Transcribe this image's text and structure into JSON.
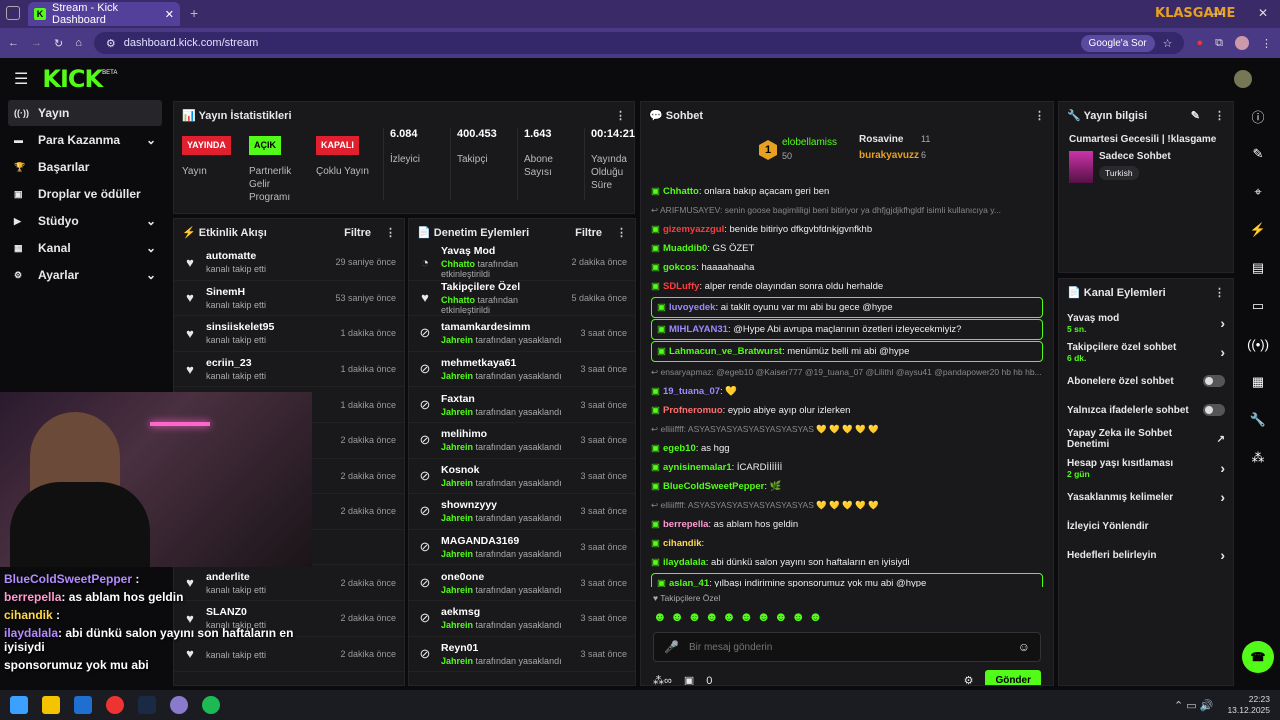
{
  "browser": {
    "tab_title": "Stream - Kick Dashboard",
    "url": "dashboard.kick.com/stream",
    "google_btn": "Google'a Sor",
    "overlay_logo": "KLASGAME"
  },
  "header": {
    "logo": "KICK",
    "beta": "BETA"
  },
  "sidebar": {
    "items": [
      {
        "label": "Yayın",
        "icon": "stream-icon",
        "expand": false
      },
      {
        "label": "Para Kazanma",
        "icon": "money-icon",
        "expand": true
      },
      {
        "label": "Başarılar",
        "icon": "trophy-icon",
        "expand": false
      },
      {
        "label": "Droplar ve ödüller",
        "icon": "gift-icon",
        "expand": false
      },
      {
        "label": "Stüdyo",
        "icon": "video-icon",
        "expand": true
      },
      {
        "label": "Kanal",
        "icon": "channel-icon",
        "expand": true
      },
      {
        "label": "Ayarlar",
        "icon": "gear-icon",
        "expand": true
      }
    ]
  },
  "stats": {
    "title": "Yayın İstatistikleri",
    "items": [
      {
        "badge": "YAYINDA",
        "label": "Yayın"
      },
      {
        "badge": "AÇIK",
        "label": "Partnerlik Gelir Programı"
      },
      {
        "badge": "KAPALI",
        "label": "Çoklu Yayın"
      },
      {
        "value": "6.084",
        "label": "İzleyici"
      },
      {
        "value": "400.453",
        "label": "Takipçi"
      },
      {
        "value": "1.643",
        "label": "Abone Sayısı"
      },
      {
        "value": "00:14:21",
        "label": "Yayında Olduğu Süre"
      }
    ]
  },
  "activity": {
    "title": "Etkinlik Akışı",
    "filter": "Filtre",
    "rows": [
      {
        "name": "automatte",
        "sub": "kanalı takip etti",
        "time": "29 saniye önce"
      },
      {
        "name": "SinemH",
        "sub": "kanalı takip etti",
        "time": "53 saniye önce"
      },
      {
        "name": "sinsiiskelet95",
        "sub": "kanalı takip etti",
        "time": "1 dakika önce"
      },
      {
        "name": "ecriin_23",
        "sub": "kanalı takip etti",
        "time": "1 dakika önce"
      },
      {
        "name": "",
        "sub": "",
        "time": "1 dakika önce"
      },
      {
        "name": "",
        "sub": "",
        "time": "2 dakika önce"
      },
      {
        "name": "",
        "sub": "",
        "time": "2 dakika önce"
      },
      {
        "name": "",
        "sub": "r! Toplam abonelik",
        "time": "2 dakika önce"
      },
      {
        "name": "",
        "sub": "",
        "time": ""
      },
      {
        "name": "anderlite",
        "sub": "kanalı takip etti",
        "time": "2 dakika önce"
      },
      {
        "name": "SLANZ0",
        "sub": "kanalı takip etti",
        "time": "2 dakika önce"
      },
      {
        "name": "",
        "sub": "kanalı takip etti",
        "time": "2 dakika önce"
      }
    ]
  },
  "moderation": {
    "title": "Denetim Eylemleri",
    "filter": "Filtre",
    "rows": [
      {
        "name": "Yavaş Mod",
        "by": "Chhatto",
        "sub": " tarafından etkinleştirildi",
        "time": "2 dakika önce",
        "icon": "slow-icon"
      },
      {
        "name": "Takipçilere Özel",
        "by": "Chhatto",
        "sub": " tarafından etkinleştirildi",
        "time": "5 dakika önce",
        "icon": "heart-icon"
      },
      {
        "name": "tamamkardesimm",
        "by": "Jahrein",
        "sub": " tarafından yasaklandı",
        "time": "3 saat önce",
        "icon": "ban-icon"
      },
      {
        "name": "mehmetkaya61",
        "by": "Jahrein",
        "sub": " tarafından yasaklandı",
        "time": "3 saat önce",
        "icon": "ban-icon"
      },
      {
        "name": "Faxtan",
        "by": "Jahrein",
        "sub": " tarafından yasaklandı",
        "time": "3 saat önce",
        "icon": "ban-icon"
      },
      {
        "name": "melihimo",
        "by": "Jahrein",
        "sub": " tarafından yasaklandı",
        "time": "3 saat önce",
        "icon": "ban-icon"
      },
      {
        "name": "Kosnok",
        "by": "Jahrein",
        "sub": " tarafından yasaklandı",
        "time": "3 saat önce",
        "icon": "ban-icon"
      },
      {
        "name": "shownzyyy",
        "by": "Jahrein",
        "sub": " tarafından yasaklandı",
        "time": "3 saat önce",
        "icon": "ban-icon"
      },
      {
        "name": "MAGANDA3169",
        "by": "Jahrein",
        "sub": " tarafından yasaklandı",
        "time": "3 saat önce",
        "icon": "ban-icon"
      },
      {
        "name": "one0one",
        "by": "Jahrein",
        "sub": " tarafından yasaklandı",
        "time": "3 saat önce",
        "icon": "ban-icon"
      },
      {
        "name": "aekmsg",
        "by": "Jahrein",
        "sub": " tarafından yasaklandı",
        "time": "3 saat önce",
        "icon": "ban-icon"
      },
      {
        "name": "Reyn01",
        "by": "Jahrein",
        "sub": " tarafından yasaklandı",
        "time": "3 saat önce",
        "icon": "ban-icon"
      }
    ]
  },
  "chat": {
    "title": "Sohbet",
    "top": [
      {
        "rank": "1",
        "name": "elobellamiss",
        "count": "50"
      },
      {
        "name": "Rosavine",
        "count": "11"
      },
      {
        "name": "burakyavuzz",
        "count": "6"
      }
    ],
    "messages": [
      {
        "u": "Chhatto",
        "c": "#53fc18",
        "m": ": onlara bakıp açacam geri ben",
        "t": "n"
      },
      {
        "u": "",
        "c": "",
        "m": "ARIFMUSAYEV: senin goose bagimliligi beni bitiriyor ya dhfjgjdjkfhgldf isimli kullanıcıya y...",
        "t": "sys"
      },
      {
        "u": "gizemyazzgul",
        "c": "#ff3b3b",
        "m": ": benide bitiriyo dfkgvbfdnkjgvnfkhb",
        "t": "n"
      },
      {
        "u": "Muaddib0",
        "c": "#53fc18",
        "m": ": GS ÖZET",
        "t": "n"
      },
      {
        "u": "gokcos",
        "c": "#53fc18",
        "m": ": haaaahaaha",
        "t": "n"
      },
      {
        "u": "SDLuffy",
        "c": "#ff3b3b",
        "m": ": alper rende olayından sonra oldu herhalde",
        "t": "n"
      },
      {
        "u": "luvoyedek",
        "c": "#9b8bff",
        "m": ": ai taklit oyunu var mı abi bu gece @hype",
        "t": "hl"
      },
      {
        "u": "MIHLAYAN31",
        "c": "#9b8bff",
        "m": ": @Hype Abi avrupa maçlarının özetleri izleyecekmiyiz?",
        "t": "hl"
      },
      {
        "u": "Lahmacun_ve_Bratwurst",
        "c": "#53fc18",
        "m": ": menümüz belli mi abi @hype",
        "t": "hl"
      },
      {
        "u": "",
        "c": "",
        "m": "ensaryapmaz: @egeb10 @Kaiser777 @19_tuana_07 @Lilithl @aysu41 @pandapower20 hb hb hb...",
        "t": "sys"
      },
      {
        "u": "19_tuana_07",
        "c": "#9b8bff",
        "m": ": 💛",
        "t": "n"
      },
      {
        "u": "Profneromuo",
        "c": "#ff7070",
        "m": ": eypio abiye ayıp olur izlerken",
        "t": "n"
      },
      {
        "u": "",
        "c": "",
        "m": "elliiiffff: ASYASYASYASYASYASYASYAS 💛 💛 💛 💛 💛",
        "t": "sys"
      },
      {
        "u": "egeb10",
        "c": "#53fc18",
        "m": ": as hgg",
        "t": "n"
      },
      {
        "u": "aynisinemalar1",
        "c": "#53fc18",
        "m": ": İCARDİİİİİİ",
        "t": "n"
      },
      {
        "u": "BlueColdSweetPepper",
        "c": "#53fc18",
        "m": ": 🌿",
        "t": "n"
      },
      {
        "u": "",
        "c": "",
        "m": "elliiiffff: ASYASYASYASYASYASYASYAS 💛 💛 💛 💛 💛",
        "t": "sys"
      },
      {
        "u": "berrepella",
        "c": "#ff9bd0",
        "m": ": as ablam hos geldin",
        "t": "n"
      },
      {
        "u": "cihandik",
        "c": "#ffd84a",
        "m": ":",
        "t": "n"
      },
      {
        "u": "ilaydalala",
        "c": "#53fc18",
        "m": ": abi dünkü salon yayını son haftaların en iyisiydi",
        "t": "n"
      },
      {
        "u": "aslan_41",
        "c": "#53fc18",
        "m": ": yılbaşı indirimine sponsorumuz yok mu abi @hype",
        "t": "hl"
      }
    ],
    "followers_only": "Takipçilere Özel",
    "placeholder": "Bir mesaj gönderin",
    "points": "0",
    "send": "Gönder"
  },
  "info": {
    "title": "Yayın bilgisi",
    "stream_title": "Cumartesi Gecesili | !klasgame",
    "category": "Sadece Sohbet",
    "tag": "Turkish"
  },
  "actions": {
    "title": "Kanal Eylemleri",
    "items": [
      {
        "label": "Yavaş mod",
        "sub": "5 sn.",
        "kind": "arrow"
      },
      {
        "label": "Takipçilere özel sohbet",
        "sub": "6 dk.",
        "kind": "arrow"
      },
      {
        "label": "Abonelere özel sohbet",
        "sub": "",
        "kind": "toggle"
      },
      {
        "label": "Yalnızca ifadelerle sohbet",
        "sub": "",
        "kind": "toggle"
      },
      {
        "label": "Yapay Zeka ile Sohbet Denetimi",
        "sub": "",
        "kind": "ext"
      },
      {
        "label": "Hesap yaşı kısıtlaması",
        "sub": "2 gün",
        "kind": "arrow"
      },
      {
        "label": "Yasaklanmış kelimeler",
        "sub": "",
        "kind": "arrow"
      },
      {
        "label": "İzleyici Yönlendir",
        "sub": "",
        "kind": "none"
      },
      {
        "label": "Hedefleri belirleyin",
        "sub": "",
        "kind": "arrow"
      }
    ]
  },
  "overlay": [
    {
      "u": "BlueColdSweetPepper",
      "m": " :",
      "c": "#b58cff"
    },
    {
      "u": "berrepella",
      "m": ": as ablam hos geldin",
      "c": "#ff9bd0"
    },
    {
      "u": "cihandik",
      "m": " :",
      "c": "#ffd84a"
    },
    {
      "u": "ilaydalala",
      "m": ": abi dünkü salon yayını son haftaların en iyisiydi",
      "c": "#b58cff"
    },
    {
      "u": "",
      "m": "sponsorumuz yok mu abi",
      "c": "#fff"
    }
  ],
  "taskbar": {
    "time": "22:23",
    "date": "13.12.2025"
  }
}
